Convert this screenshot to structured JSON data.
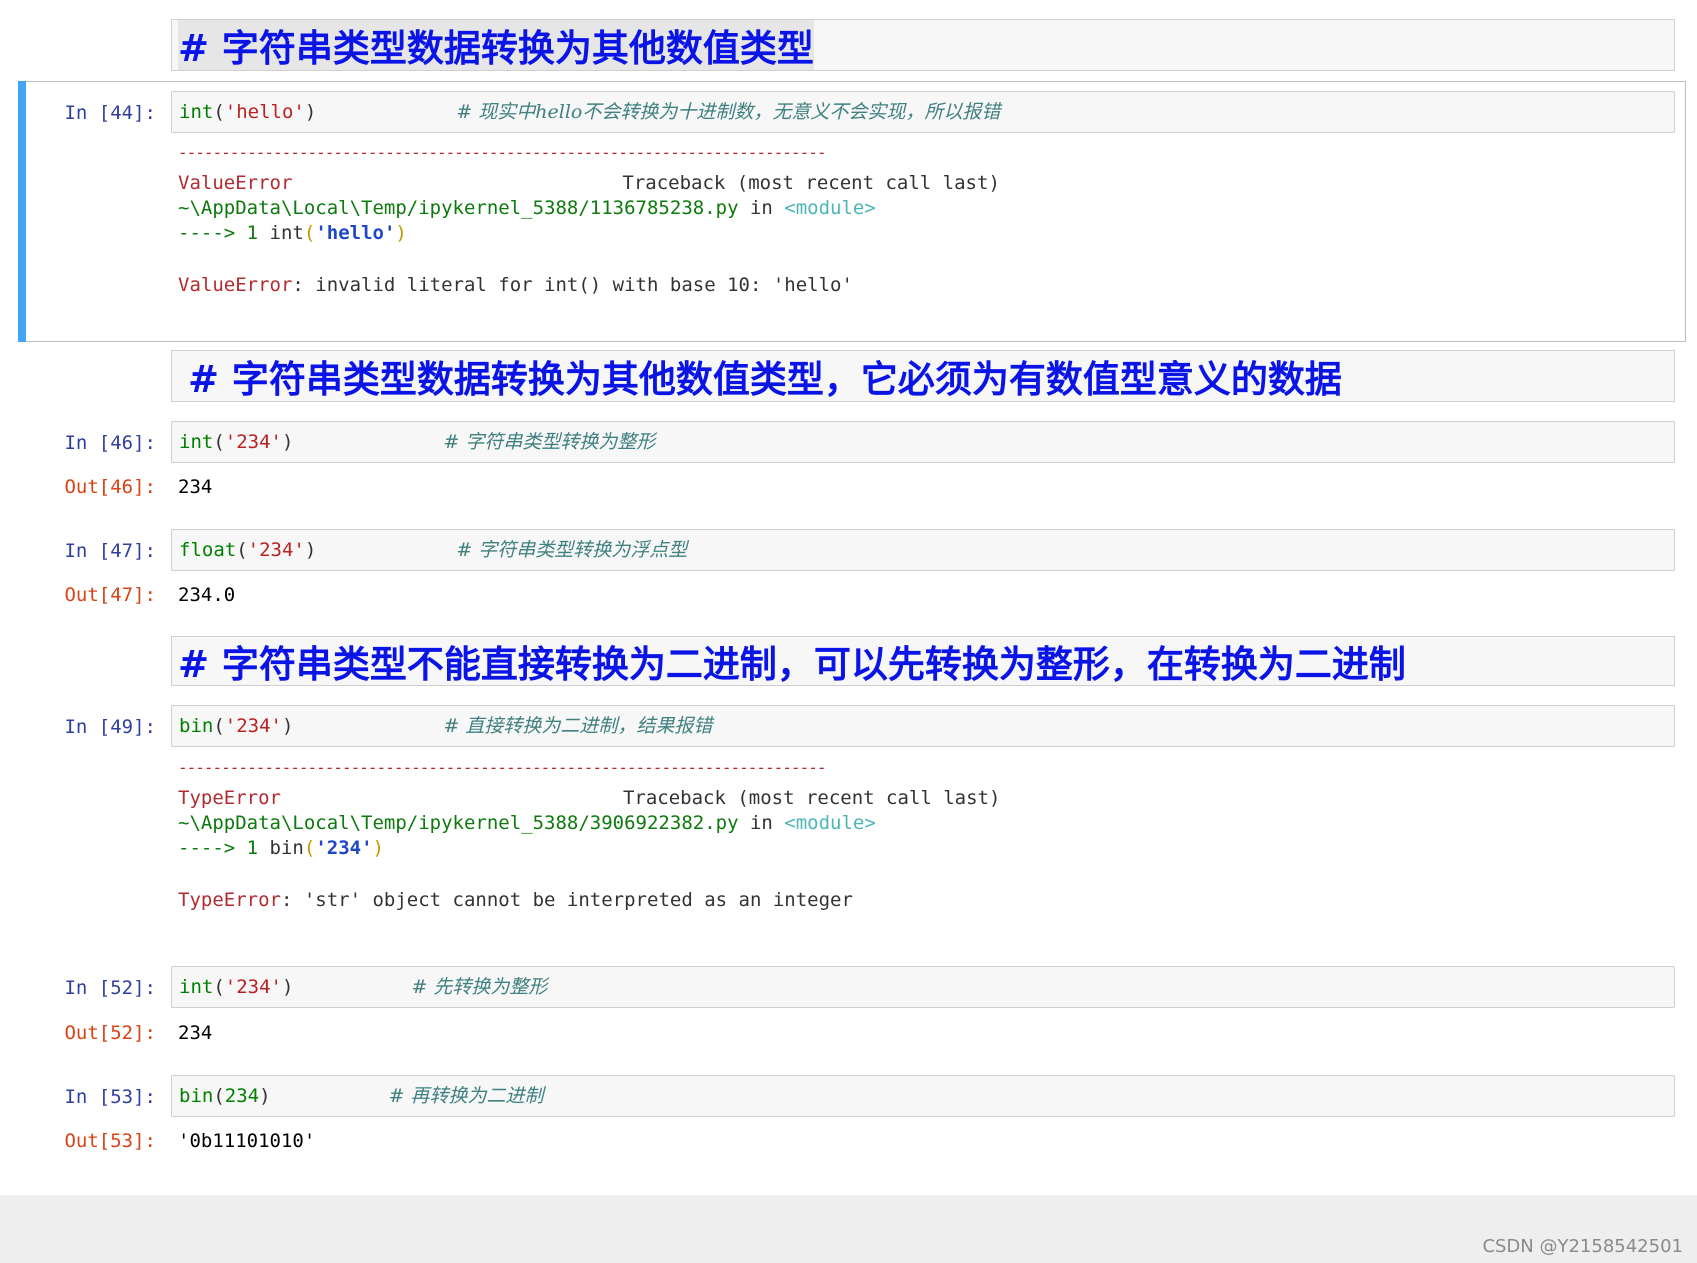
{
  "cells": {
    "md1": {
      "heading": "# 字符串类型数据转换为其他数值类型"
    },
    "c44": {
      "prompt": "In  [44]:",
      "code_func": "int",
      "code_open": "(",
      "code_arg": "'hello'",
      "code_close": ")",
      "comment": "# 现实中hello不会转换为十进制数，无意义不会实现，所以报错",
      "tb": {
        "dashes": "---------------------------------------------------------------------------",
        "err_name": "ValueError",
        "traceback_label": "Traceback (most recent call last)",
        "file_path": "~\\AppData\\Local\\Temp/ipykernel_5388/1136785238.py",
        "in_word": " in ",
        "module": "<module>",
        "arrow": "---->",
        "line_no": " 1 ",
        "line_func": "int",
        "line_open": "(",
        "line_arg": "'hello'",
        "line_close": ")",
        "final_name": "ValueError",
        "final_msg": ": invalid literal for int() with base 10: 'hello'"
      }
    },
    "md2": {
      "heading": "# 字符串类型数据转换为其他数值类型，它必须为有数值型意义的数据"
    },
    "c46": {
      "prompt": "In  [46]:",
      "code_func": "int",
      "code_open": "(",
      "code_arg": "'234'",
      "code_close": ")",
      "comment": "# 字符串类型转换为整形",
      "out_prompt": "Out[46]:",
      "out": "234"
    },
    "c47": {
      "prompt": "In  [47]:",
      "code_func": "float",
      "code_open": "(",
      "code_arg": "'234'",
      "code_close": ")",
      "comment": "# 字符串类型转换为浮点型",
      "out_prompt": "Out[47]:",
      "out": "234.0"
    },
    "md3": {
      "heading": "# 字符串类型不能直接转换为二进制，可以先转换为整形，在转换为二进制"
    },
    "c49": {
      "prompt": "In  [49]:",
      "code_func": "bin",
      "code_open": "(",
      "code_arg": "'234'",
      "code_close": ")",
      "comment": "# 直接转换为二进制，结果报错",
      "tb": {
        "dashes": "---------------------------------------------------------------------------",
        "err_name": "TypeError",
        "traceback_label": "Traceback (most recent call last)",
        "file_path": "~\\AppData\\Local\\Temp/ipykernel_5388/3906922382.py",
        "in_word": " in ",
        "module": "<module>",
        "arrow": "---->",
        "line_no": " 1 ",
        "line_func": "bin",
        "line_open": "(",
        "line_arg": "'234'",
        "line_close": ")",
        "final_name": "TypeError",
        "final_msg": ": 'str' object cannot be interpreted as an integer"
      }
    },
    "c52": {
      "prompt": "In  [52]:",
      "code_func": "int",
      "code_open": "(",
      "code_arg": "'234'",
      "code_close": ")",
      "comment": "# 先转换为整形",
      "out_prompt": "Out[52]:",
      "out": "234"
    },
    "c53": {
      "prompt": "In  [53]:",
      "code_func": "bin",
      "code_open": "(",
      "code_arg": "234",
      "code_close": ")",
      "comment": "# 再转换为二进制",
      "out_prompt": "Out[53]:",
      "out": "'0b11101010'"
    }
  },
  "watermark": "CSDN @Y2158542501",
  "colors": {
    "heading": "#0a14e6",
    "prompt_in": "#303f9f",
    "prompt_out": "#d84315",
    "selected_bar": "#42a5f5"
  }
}
